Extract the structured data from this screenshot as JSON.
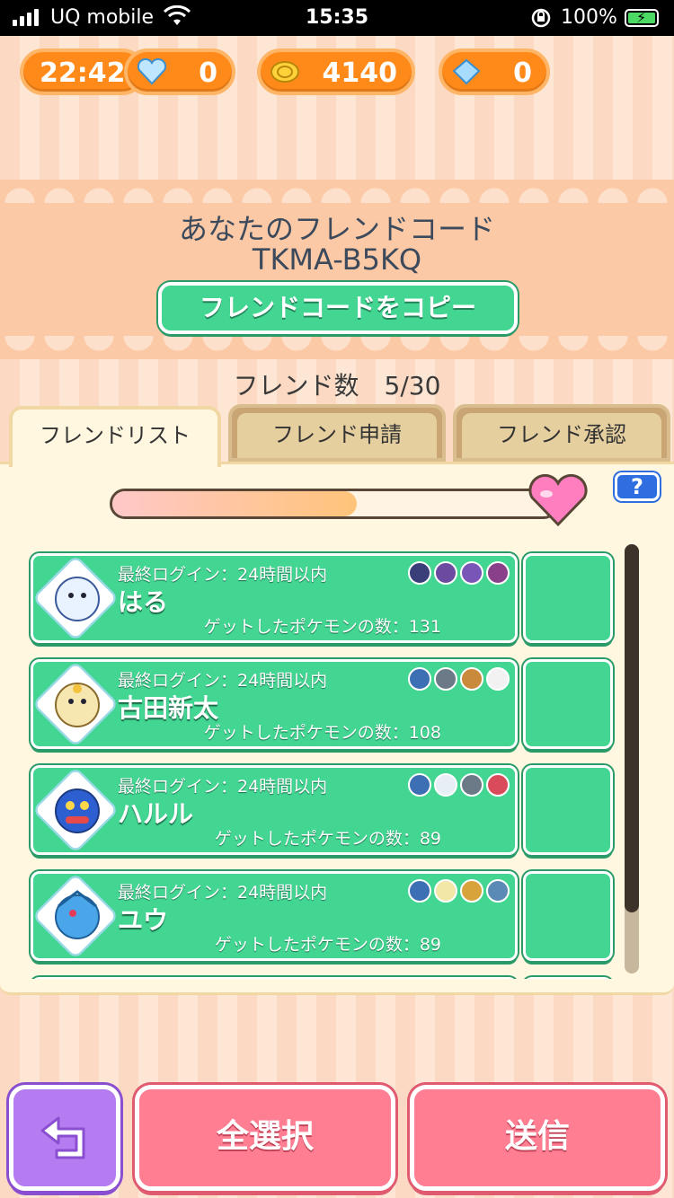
{
  "status_bar": {
    "carrier": "UQ mobile",
    "time": "15:35",
    "battery": "100%"
  },
  "currency": {
    "timer": "22:42",
    "hearts": "0",
    "coins": "4140",
    "gems": "0"
  },
  "friend_code": {
    "title": "あなたのフレンドコード",
    "code": "TKMA-B5KQ",
    "copy_button": "フレンドコードをコピー"
  },
  "friend_count": "フレンド数　5/30",
  "tabs": [
    {
      "label": "フレンドリスト",
      "active": true
    },
    {
      "label": "フレンド申請",
      "active": false
    },
    {
      "label": "フレンド承認",
      "active": false
    }
  ],
  "slider": {
    "value": 0.55
  },
  "help_label": "?",
  "friends": [
    {
      "login": "最終ログイン：24時間以内",
      "name": "はる",
      "caught": "ゲットしたポケモンの数：131",
      "avatar_color": "#e9f2ff",
      "minis": [
        "#3a3f7a",
        "#6b4aa0",
        "#7a55b8",
        "#8a3f8a"
      ]
    },
    {
      "login": "最終ログイン：24時間以内",
      "name": "古田新太",
      "caught": "ゲットしたポケモンの数：108",
      "avatar_color": "#f6e6b0",
      "minis": [
        "#3d6fb5",
        "#6b7a86",
        "#c98a3c",
        "#f2f2f2"
      ]
    },
    {
      "login": "最終ログイン：24時間以内",
      "name": "ハルル",
      "caught": "ゲットしたポケモンの数：89",
      "avatar_color": "#2e5fd1",
      "minis": [
        "#3d6fb5",
        "#e8eef5",
        "#6b7a86",
        "#d94a5a"
      ]
    },
    {
      "login": "最終ログイン：24時間以内",
      "name": "ユウ",
      "caught": "ゲットしたポケモンの数：89",
      "avatar_color": "#4aa6e8",
      "minis": [
        "#3d6fb5",
        "#f3e7a8",
        "#d9a33c",
        "#5a8ab5"
      ]
    }
  ],
  "buttons": {
    "select_all": "全選択",
    "send": "送信"
  },
  "colors": {
    "accent_green": "#43d693",
    "button_pink": "#ff7e92",
    "back_purple": "#b57bf0",
    "pill_orange": "#ff8a1a"
  }
}
